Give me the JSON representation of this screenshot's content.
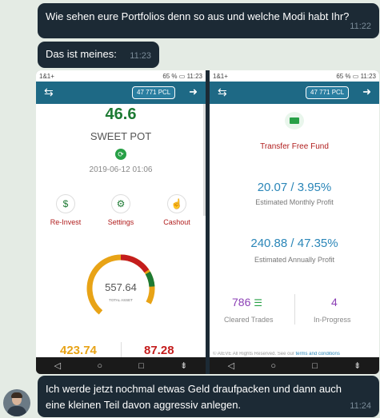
{
  "messages": [
    {
      "text": "Wie sehen eure Portfolios denn so aus und welche Modi habt Ihr?",
      "time": "11:22"
    },
    {
      "text": "Das ist meines:",
      "time": "11:23"
    },
    {
      "text": "Ich werde jetzt nochmal etwas Geld draufpacken und dann auch eine kleinen Teil davon aggressiv anlegen.",
      "time": "11:24"
    }
  ],
  "phone_status": {
    "carrier": "1&1+",
    "battery": "65 %",
    "time": "11:23"
  },
  "left_screen": {
    "balance_badge": "47 771 PCL",
    "pot_value": "46.6",
    "pot_name": "SWEET POT",
    "pot_date": "2019-06-12 01:06",
    "actions": [
      {
        "label": "Re-Invest",
        "icon": "dollar-icon"
      },
      {
        "label": "Settings",
        "icon": "gears-icon"
      },
      {
        "label": "Cashout",
        "icon": "hand-pointer-icon"
      }
    ],
    "gauge_value": "557.64",
    "gauge_label": "TOTAL ASSET",
    "stat_left": "423.74",
    "stat_right": "87.28",
    "colors": {
      "green": "#1d7a33",
      "orange": "#e8a316",
      "red": "#c41d1d"
    }
  },
  "right_screen": {
    "balance_badge": "47 771 PCL",
    "transfer_label": "Transfer Free Fund",
    "monthly_value": "20.07 / 3.95%",
    "monthly_label": "Estimated Monthly Profit",
    "annual_value": "240.88 / 47.35%",
    "annual_label": "Estimated Annually Profit",
    "cleared_trades": "786",
    "cleared_label": "Cleared Trades",
    "in_progress": "4",
    "in_progress_label": "In-Progress",
    "footer": "© AIEVE All Rights Reserved. See our",
    "footer_link": "terms and conditions"
  }
}
